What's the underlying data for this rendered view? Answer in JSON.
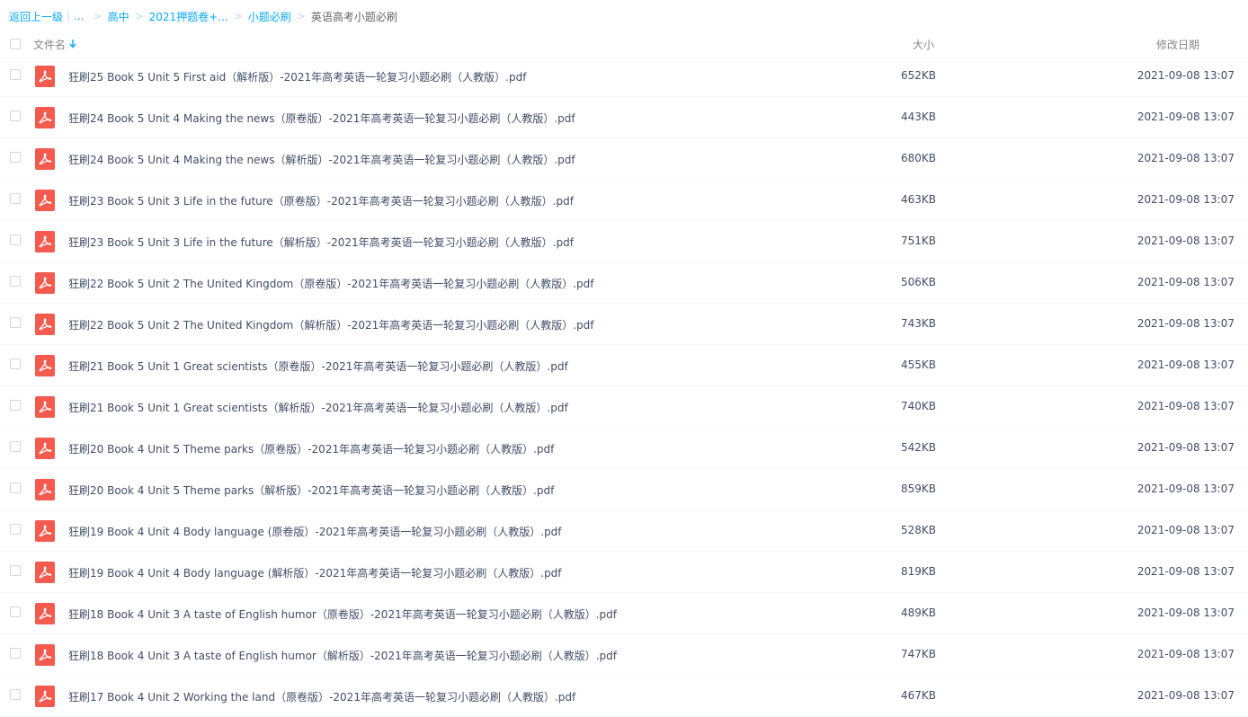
{
  "breadcrumb": {
    "back": "返回上一级",
    "separator": "|",
    "ellipsis": "...",
    "items": [
      "高中",
      "2021押题卷+...",
      "小题必刷"
    ],
    "arrow": ">",
    "current": "英语高考小题必刷"
  },
  "header": {
    "name": "文件名",
    "size": "大小",
    "date": "修改日期"
  },
  "files": [
    {
      "name": "狂刷25 Book 5 Unit 5 First aid（解析版）-2021年高考英语一轮复习小题必刷（人教版）.pdf",
      "size": "652KB",
      "date": "2021-09-08 13:07"
    },
    {
      "name": "狂刷24 Book 5 Unit 4 Making the news（原卷版）-2021年高考英语一轮复习小题必刷（人教版）.pdf",
      "size": "443KB",
      "date": "2021-09-08 13:07"
    },
    {
      "name": "狂刷24 Book 5 Unit 4 Making the news（解析版）-2021年高考英语一轮复习小题必刷（人教版）.pdf",
      "size": "680KB",
      "date": "2021-09-08 13:07"
    },
    {
      "name": "狂刷23 Book 5 Unit 3 Life in the future（原卷版）-2021年高考英语一轮复习小题必刷（人教版）.pdf",
      "size": "463KB",
      "date": "2021-09-08 13:07"
    },
    {
      "name": "狂刷23 Book 5 Unit 3 Life in the future（解析版）-2021年高考英语一轮复习小题必刷（人教版）.pdf",
      "size": "751KB",
      "date": "2021-09-08 13:07"
    },
    {
      "name": "狂刷22 Book 5 Unit 2 The United Kingdom（原卷版）-2021年高考英语一轮复习小题必刷（人教版）.pdf",
      "size": "506KB",
      "date": "2021-09-08 13:07"
    },
    {
      "name": "狂刷22 Book 5 Unit 2 The United Kingdom（解析版）-2021年高考英语一轮复习小题必刷（人教版）.pdf",
      "size": "743KB",
      "date": "2021-09-08 13:07"
    },
    {
      "name": "狂刷21 Book 5 Unit 1 Great scientists（原卷版）-2021年高考英语一轮复习小题必刷（人教版）.pdf",
      "size": "455KB",
      "date": "2021-09-08 13:07"
    },
    {
      "name": "狂刷21 Book 5 Unit 1 Great scientists（解析版）-2021年高考英语一轮复习小题必刷（人教版）.pdf",
      "size": "740KB",
      "date": "2021-09-08 13:07"
    },
    {
      "name": "狂刷20 Book 4 Unit 5 Theme parks（原卷版）-2021年高考英语一轮复习小题必刷（人教版）.pdf",
      "size": "542KB",
      "date": "2021-09-08 13:07"
    },
    {
      "name": "狂刷20 Book 4 Unit 5 Theme parks（解析版）-2021年高考英语一轮复习小题必刷（人教版）.pdf",
      "size": "859KB",
      "date": "2021-09-08 13:07"
    },
    {
      "name": "狂刷19 Book 4 Unit 4 Body language (原卷版）-2021年高考英语一轮复习小题必刷（人教版）.pdf",
      "size": "528KB",
      "date": "2021-09-08 13:07"
    },
    {
      "name": "狂刷19 Book 4 Unit 4 Body language (解析版）-2021年高考英语一轮复习小题必刷（人教版）.pdf",
      "size": "819KB",
      "date": "2021-09-08 13:07"
    },
    {
      "name": "狂刷18 Book 4 Unit 3 A taste of English humor（原卷版）-2021年高考英语一轮复习小题必刷（人教版）.pdf",
      "size": "489KB",
      "date": "2021-09-08 13:07"
    },
    {
      "name": "狂刷18 Book 4 Unit 3 A taste of English humor（解析版）-2021年高考英语一轮复习小题必刷（人教版）.pdf",
      "size": "747KB",
      "date": "2021-09-08 13:07"
    },
    {
      "name": "狂刷17 Book 4 Unit 2 Working the land（原卷版）-2021年高考英语一轮复习小题必刷（人教版）.pdf",
      "size": "467KB",
      "date": "2021-09-08 13:07"
    }
  ],
  "colors": {
    "accent": "#09aaff",
    "pdf_icon": "#f55a4e",
    "text": "#424e67",
    "divider": "#f2f6fd"
  },
  "icons": {
    "file": "pdf-icon",
    "sort": "sort-arrow-down-icon"
  }
}
